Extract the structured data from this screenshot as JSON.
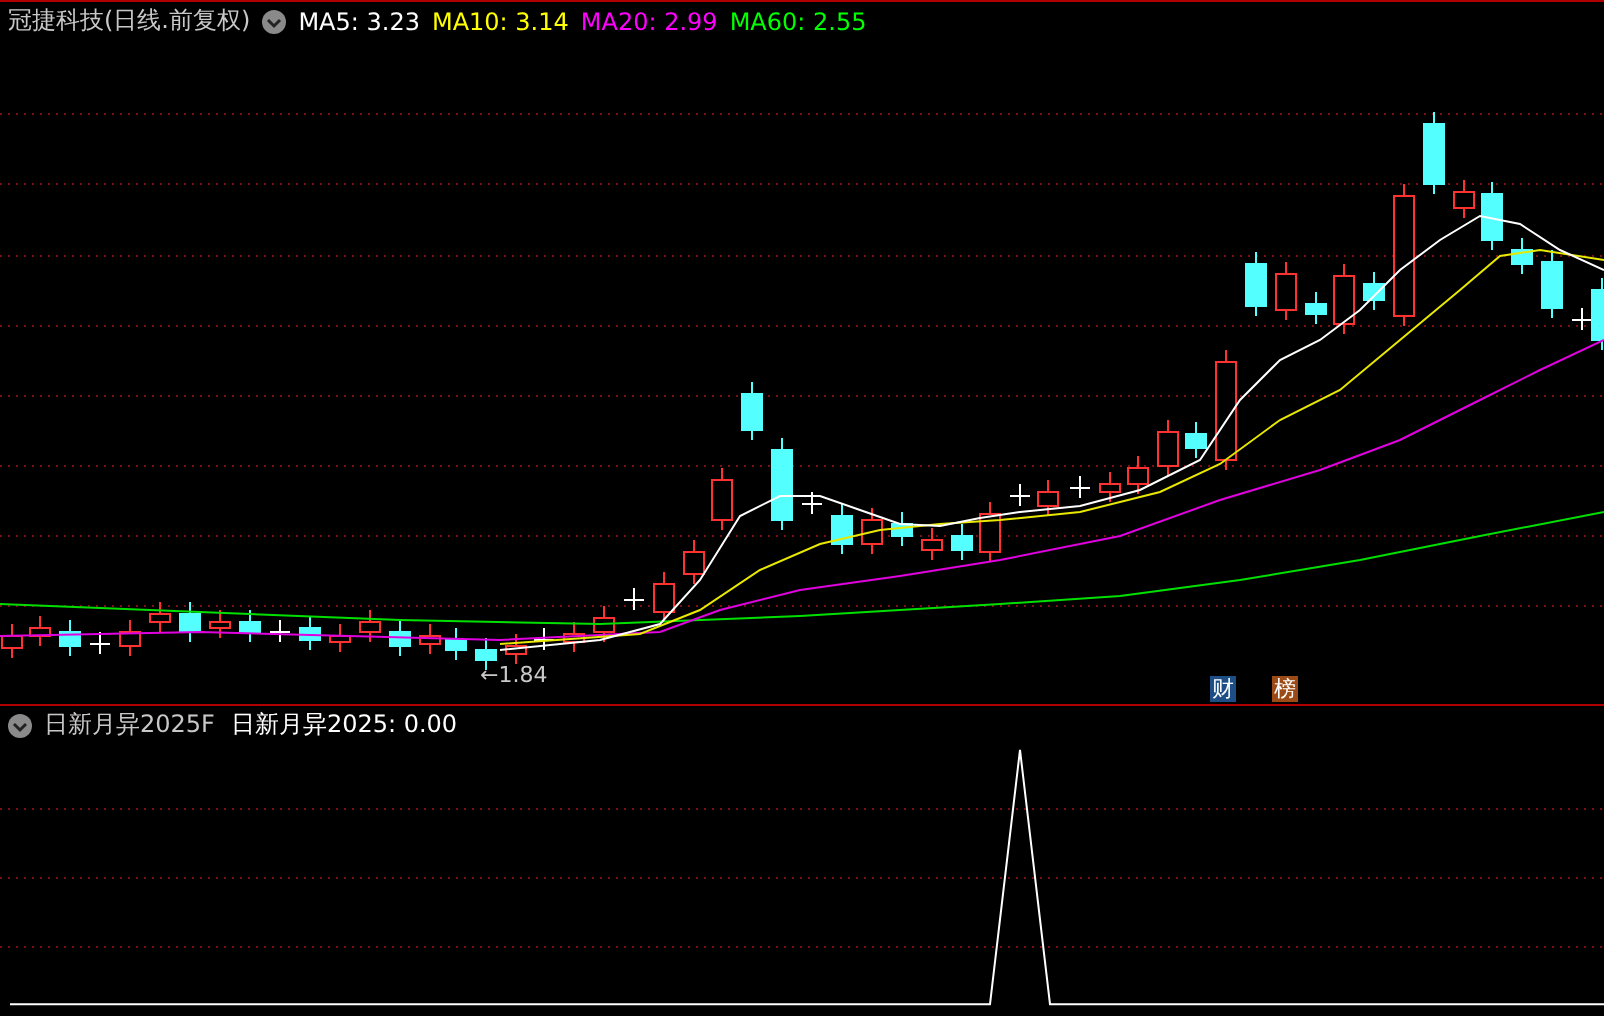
{
  "main_panel": {
    "title": "冠捷科技(日线.前复权)",
    "indicators": [
      {
        "label": "MA5: 3.23",
        "color": "#ffffff"
      },
      {
        "label": "MA10: 3.14",
        "color": "#ffff00"
      },
      {
        "label": "MA20: 2.99",
        "color": "#ff00ff"
      },
      {
        "label": "MA60: 2.55",
        "color": "#00ff00"
      }
    ],
    "low_marker": "←1.84",
    "badges": [
      {
        "label": "财",
        "color": "#1d4f86"
      },
      {
        "label": "榜",
        "color": "#9c4a16"
      }
    ]
  },
  "sub_panel": {
    "title": "日新月异2025F",
    "reading": "日新月异2025: 0.00"
  }
}
